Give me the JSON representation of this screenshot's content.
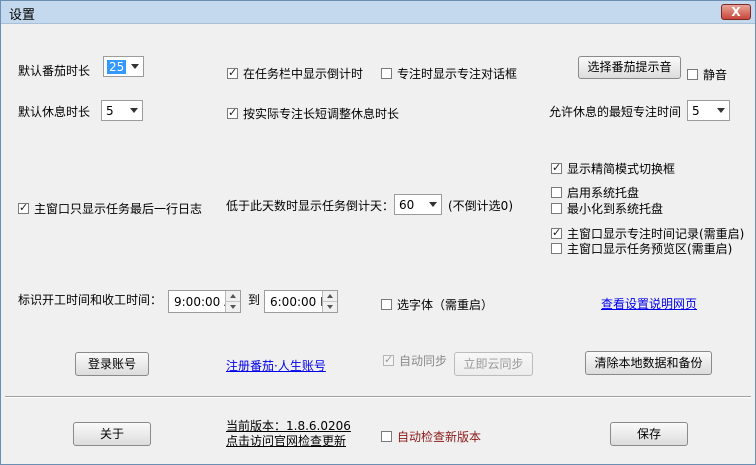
{
  "window": {
    "title": "设置",
    "close_label": "X"
  },
  "pomodoro": {
    "label": "默认番茄时长",
    "value": "25"
  },
  "rest": {
    "label": "默认休息时长",
    "value": "5"
  },
  "taskbar_countdown": {
    "label": "在任务栏中显示倒计时",
    "checked": true
  },
  "focus_dialog": {
    "label": "专注时显示专注对话框",
    "checked": false
  },
  "adjust_rest": {
    "label": "按实际专注长短调整休息时长",
    "checked": true
  },
  "sound_button": {
    "label": "选择番茄提示音"
  },
  "mute": {
    "label": "静音",
    "checked": false
  },
  "min_focus": {
    "label": "允许休息的最短专注时间",
    "value": "5"
  },
  "mode_toggle": {
    "label": "显示精简模式切换框",
    "checked": true
  },
  "tray": {
    "label": "启用系统托盘",
    "checked": false
  },
  "minimize_tray": {
    "label": "最小化到系统托盘",
    "checked": false
  },
  "last_log": {
    "label": "主窗口只显示任务最后一行日志",
    "checked": true
  },
  "countdown_days": {
    "label": "低于此天数时显示任务倒计天：",
    "value": "60",
    "note": "(不倒计选0)"
  },
  "show_focus_record": {
    "label": "主窗口显示专注时间记录(需重启)",
    "checked": true
  },
  "show_preview": {
    "label": "主窗口显示任务预览区(需重启)",
    "checked": false
  },
  "work_hours": {
    "label": "标识开工时间和收工时间：",
    "start": "9:00:00 A",
    "to": "到",
    "end": "6:00:00 P"
  },
  "font_option": {
    "label": "选字体（需重启）",
    "checked": false
  },
  "help_link": {
    "label": "查看设置说明网页"
  },
  "login_button": {
    "label": "登录账号"
  },
  "register_link": {
    "label": "注册番茄·人生账号"
  },
  "auto_sync": {
    "label": "自动同步",
    "checked": true
  },
  "sync_button": {
    "label": "立即云同步"
  },
  "clear_button": {
    "label": "清除本地数据和备份"
  },
  "about_button": {
    "label": "关于"
  },
  "version": {
    "line1": "当前版本：1.8.6.0206",
    "line2": "点击访问官网检查更新"
  },
  "auto_update": {
    "label": "自动检查新版本",
    "checked": false
  },
  "save_button": {
    "label": "保存"
  }
}
